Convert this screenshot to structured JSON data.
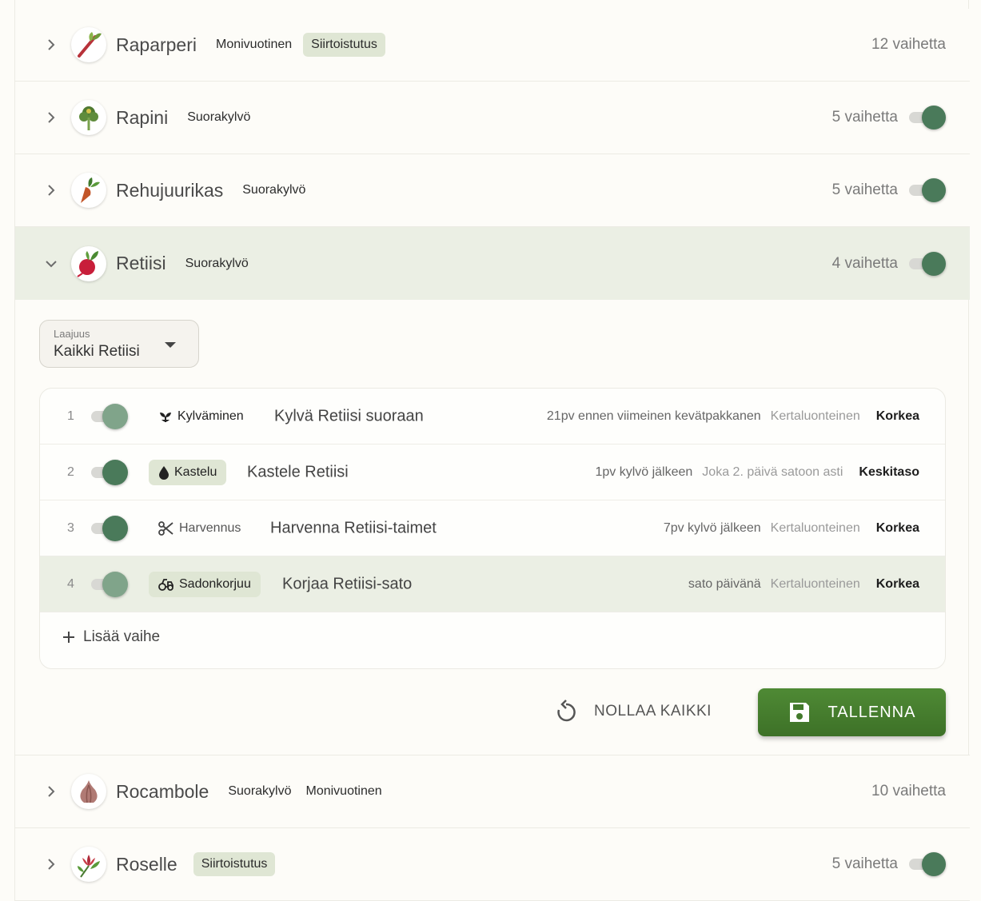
{
  "colors": {
    "accent": "#4a7a5a",
    "tag_bg": "#dfe6d4",
    "expanded_bg": "#ebefe4",
    "save_button": "#437a2c"
  },
  "plants": [
    {
      "name": "Raparperi",
      "tags": [
        "Monivuotinen",
        "Siirtoistutus"
      ],
      "steps": "12 vaihetta",
      "toggle": false,
      "icon": "rhubarb-icon"
    },
    {
      "name": "Rapini",
      "tags": [
        "Suorakylvö"
      ],
      "steps": "5 vaihetta",
      "toggle": true,
      "icon": "rapini-icon"
    },
    {
      "name": "Rehujuurikas",
      "tags": [
        "Suorakylvö"
      ],
      "steps": "5 vaihetta",
      "toggle": true,
      "icon": "beet-icon"
    },
    {
      "name": "Retiisi",
      "tags": [
        "Suorakylvö"
      ],
      "steps": "4 vaihetta",
      "toggle": true,
      "icon": "radish-icon",
      "expanded": true
    },
    {
      "name": "Rocambole",
      "tags": [
        "Suorakylvö",
        "Monivuotinen"
      ],
      "steps": "10 vaihetta",
      "toggle": false,
      "icon": "garlic-icon"
    },
    {
      "name": "Roselle",
      "tags": [
        "Siirtoistutus"
      ],
      "steps": "5 vaihetta",
      "toggle": true,
      "icon": "roselle-icon"
    }
  ],
  "scope": {
    "label": "Laajuus",
    "value": "Kaikki Retiisi"
  },
  "steps": [
    {
      "num": "1",
      "category": "Kylväminen",
      "title": "Kylvä Retiisi suoraan",
      "timing": "21pv ennen viimeinen kevätpakkanen",
      "frequency": "Kertaluonteinen",
      "priority": "Korkea",
      "icon": "sprout-icon"
    },
    {
      "num": "2",
      "category": "Kastelu",
      "title": "Kastele Retiisi",
      "timing": "1pv kylvö jälkeen",
      "frequency": "Joka 2. päivä satoon asti",
      "priority": "Keskitaso",
      "icon": "water-drop-icon"
    },
    {
      "num": "3",
      "category": "Harvennus",
      "title": "Harvenna Retiisi-taimet",
      "timing": "7pv kylvö jälkeen",
      "frequency": "Kertaluonteinen",
      "priority": "Korkea",
      "icon": "scissors-icon"
    },
    {
      "num": "4",
      "category": "Sadonkorjuu",
      "title": "Korjaa Retiisi-sato",
      "timing": "sato päivänä",
      "frequency": "Kertaluonteinen",
      "priority": "Korkea",
      "icon": "tractor-icon"
    }
  ],
  "add_step_label": "Lisää vaihe",
  "reset_label": "NOLLAA KAIKKI",
  "save_label": "TALLENNA"
}
